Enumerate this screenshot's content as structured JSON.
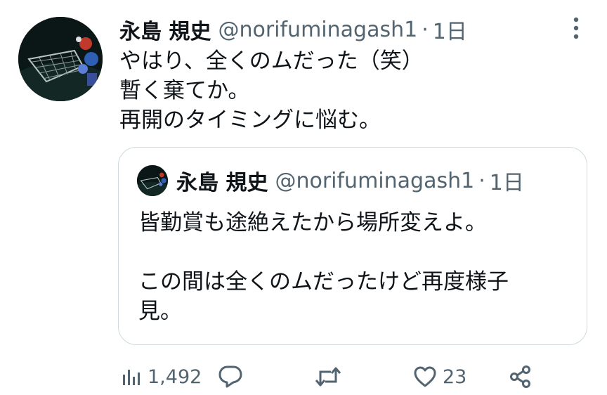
{
  "tweet": {
    "author_name": "永島 規史",
    "author_handle": "@norifuminagash1",
    "separator": "·",
    "time": "1日",
    "text_lines": [
      "やはり、全くのムだった（笑）",
      "暫く棄てか。",
      "再開のタイミングに悩む。"
    ]
  },
  "quote": {
    "author_name": "永島 規史",
    "author_handle": "@norifuminagash1",
    "separator": "·",
    "time": "1日",
    "text_lines": [
      "皆勤賞も途絶えたから場所変えよ。",
      "",
      "この間は全くのムだったけど再度様子",
      "見。"
    ]
  },
  "actions": {
    "views_icon": "analytics-icon",
    "views_count": "1,492",
    "reply_icon": "reply-icon",
    "retweet_icon": "retweet-icon",
    "like_icon": "heart-icon",
    "like_count": "23",
    "share_icon": "share-icon",
    "more_icon": "more-vertical-icon"
  },
  "colors": {
    "text": "#0f1419",
    "secondary": "#536471",
    "border": "#cfd9de"
  }
}
